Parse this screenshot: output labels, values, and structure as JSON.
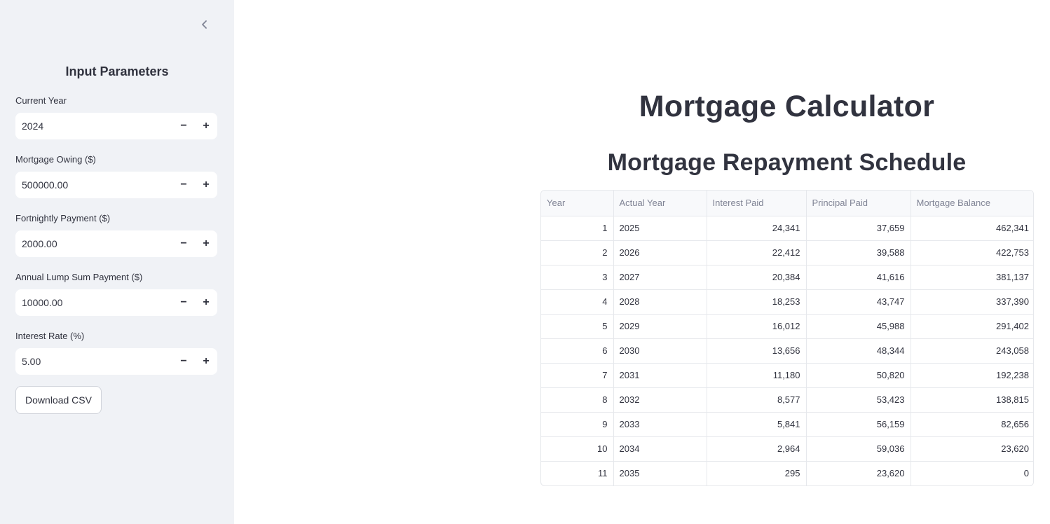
{
  "sidebar": {
    "title": "Input Parameters",
    "fields": [
      {
        "label": "Current Year",
        "value": "2024"
      },
      {
        "label": "Mortgage Owing ($)",
        "value": "500000.00"
      },
      {
        "label": "Fortnightly Payment ($)",
        "value": "2000.00"
      },
      {
        "label": "Annual Lump Sum Payment ($)",
        "value": "10000.00"
      },
      {
        "label": "Interest Rate (%)",
        "value": "5.00"
      }
    ],
    "download_label": "Download CSV",
    "step_minus": "−",
    "step_plus": "+"
  },
  "main": {
    "title": "Mortgage Calculator",
    "subtitle": "Mortgage Repayment Schedule"
  },
  "table": {
    "headers": [
      "Year",
      "Actual Year",
      "Interest Paid",
      "Principal Paid",
      "Mortgage Balance"
    ],
    "rows": [
      [
        "1",
        "2025",
        "24,341",
        "37,659",
        "462,341"
      ],
      [
        "2",
        "2026",
        "22,412",
        "39,588",
        "422,753"
      ],
      [
        "3",
        "2027",
        "20,384",
        "41,616",
        "381,137"
      ],
      [
        "4",
        "2028",
        "18,253",
        "43,747",
        "337,390"
      ],
      [
        "5",
        "2029",
        "16,012",
        "45,988",
        "291,402"
      ],
      [
        "6",
        "2030",
        "13,656",
        "48,344",
        "243,058"
      ],
      [
        "7",
        "2031",
        "11,180",
        "50,820",
        "192,238"
      ],
      [
        "8",
        "2032",
        "8,577",
        "53,423",
        "138,815"
      ],
      [
        "9",
        "2033",
        "5,841",
        "56,159",
        "82,656"
      ],
      [
        "10",
        "2034",
        "2,964",
        "59,036",
        "23,620"
      ],
      [
        "11",
        "2035",
        "295",
        "23,620",
        "0"
      ]
    ]
  },
  "icons": {
    "collapse": "chevron-left-icon"
  },
  "colors": {
    "sidebar_bg": "#f0f2f6",
    "text": "#31333f",
    "header_text": "#808495",
    "border": "#e6e8ec"
  }
}
